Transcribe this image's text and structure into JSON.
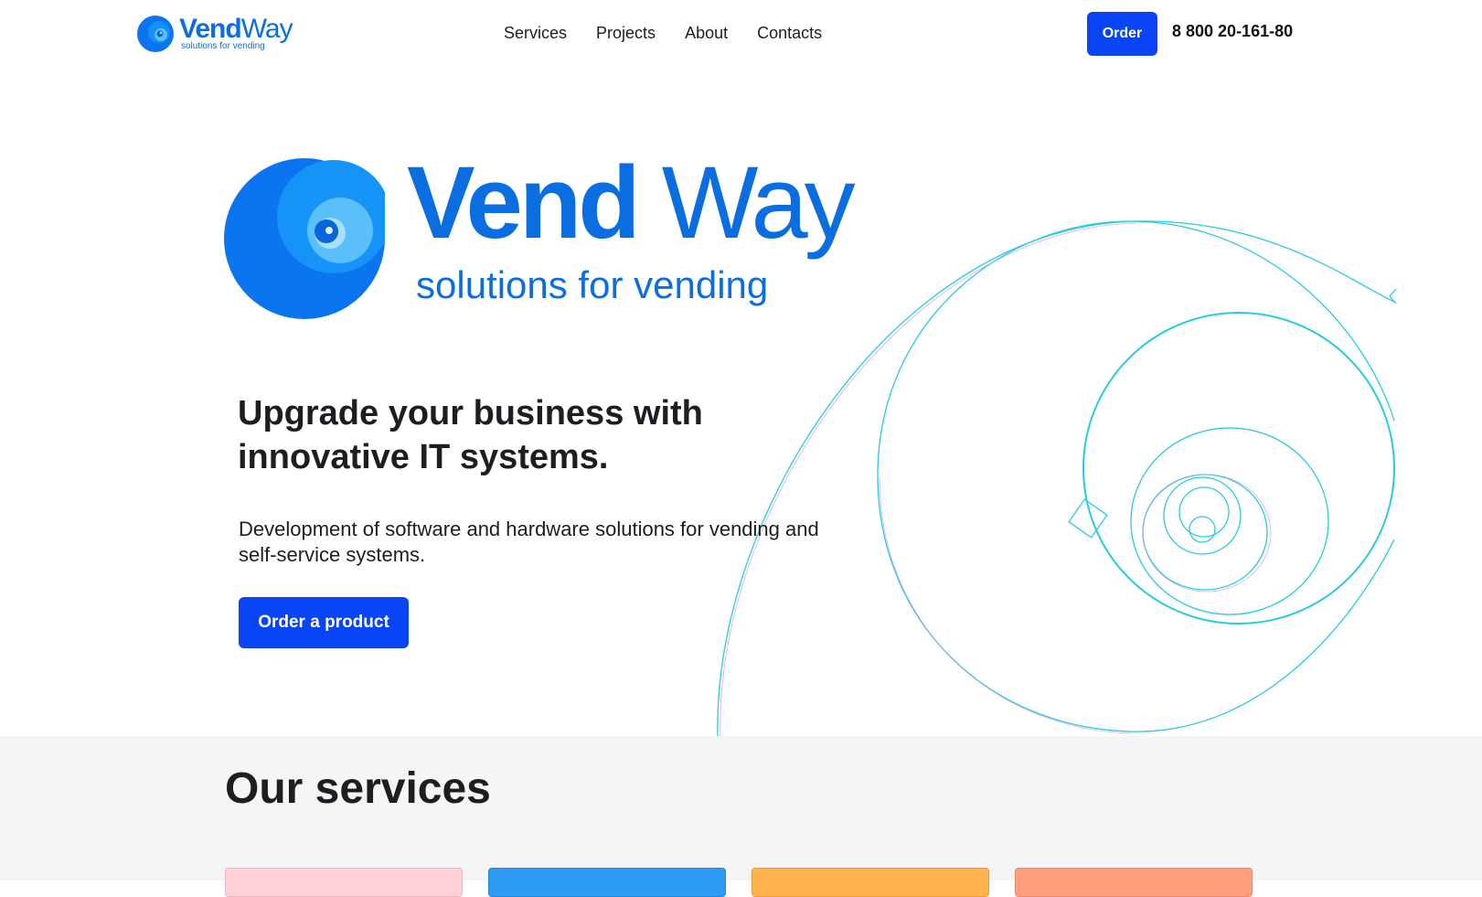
{
  "header": {
    "logo": {
      "brand_bold": "Vend",
      "brand_light": "Way",
      "tagline": "solutions for vending"
    },
    "nav": [
      {
        "label": "Services"
      },
      {
        "label": "Projects"
      },
      {
        "label": "About"
      },
      {
        "label": "Contacts"
      }
    ],
    "order_label": "Order",
    "phone": "8 800 20-161-80"
  },
  "hero": {
    "logo": {
      "brand_bold": "Vend",
      "brand_light": "Way",
      "tagline": "solutions for vending"
    },
    "headline": "Upgrade your business with innovative IT systems.",
    "subline": "Development of software and hardware solutions for vending and self-service systems.",
    "cta_label": "Order a product"
  },
  "services": {
    "title": "Our services"
  },
  "colors": {
    "accent": "#0a45f5",
    "brand": "#0b6ee0",
    "spiral": "#28cbe0"
  }
}
